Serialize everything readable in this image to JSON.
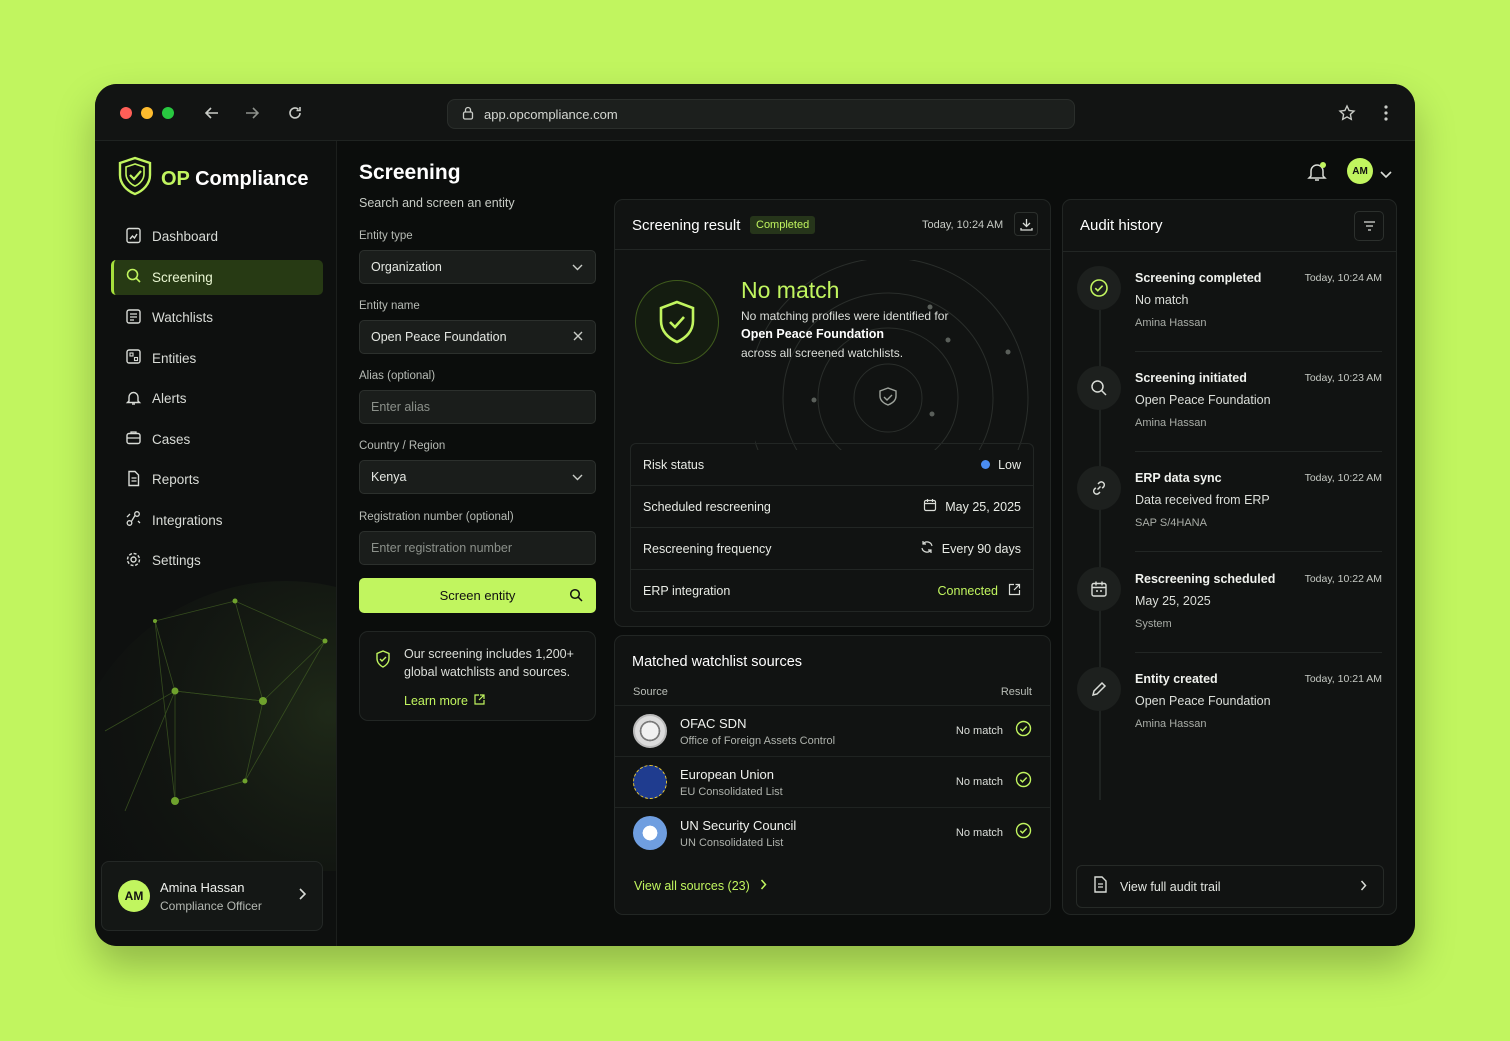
{
  "browser": {
    "url": "app.opcompliance.com"
  },
  "brand": {
    "prefix": "OP",
    "name": "Compliance"
  },
  "nav": [
    {
      "label": "Dashboard",
      "icon": "dashboard-icon"
    },
    {
      "label": "Screening",
      "icon": "search-icon",
      "active": true
    },
    {
      "label": "Watchlists",
      "icon": "list-icon"
    },
    {
      "label": "Entities",
      "icon": "entities-icon"
    },
    {
      "label": "Alerts",
      "icon": "bell-icon"
    },
    {
      "label": "Cases",
      "icon": "briefcase-icon"
    },
    {
      "label": "Reports",
      "icon": "document-icon"
    },
    {
      "label": "Integrations",
      "icon": "integrations-icon"
    },
    {
      "label": "Settings",
      "icon": "gear-icon"
    }
  ],
  "user": {
    "initials": "AM",
    "name": "Amina Hassan",
    "role": "Compliance Officer"
  },
  "page": {
    "title": "Screening",
    "subtitle": "Search and screen an entity"
  },
  "form": {
    "entity_type_label": "Entity type",
    "entity_type_value": "Organization",
    "entity_name_label": "Entity name",
    "entity_name_value": "Open Peace Foundation",
    "alias_label": "Alias (optional)",
    "alias_placeholder": "Enter alias",
    "country_label": "Country / Region",
    "country_value": "Kenya",
    "reg_label": "Registration number (optional)",
    "reg_placeholder": "Enter registration number",
    "submit": "Screen entity"
  },
  "info": {
    "text": "Our screening includes 1,200+ global watchlists and sources.",
    "link": "Learn more"
  },
  "result": {
    "title": "Screening result",
    "badge": "Completed",
    "time": "Today, 10:24 AM",
    "headline": "No match",
    "desc_1": "No matching profiles were identified for",
    "entity": "Open Peace Foundation",
    "desc_2": "across all screened watchlists.",
    "rows": [
      {
        "label": "Risk status",
        "value": "Low"
      },
      {
        "label": "Scheduled rescreening",
        "value": "May 25, 2025"
      },
      {
        "label": "Rescreening frequency",
        "value": "Every 90 days"
      },
      {
        "label": "ERP integration",
        "value": "Connected"
      }
    ]
  },
  "sources": {
    "title": "Matched watchlist sources",
    "col_source": "Source",
    "col_result": "Result",
    "items": [
      {
        "name": "OFAC SDN",
        "sub": "Office of Foreign Assets Control",
        "result": "No match"
      },
      {
        "name": "European Union",
        "sub": "EU Consolidated List",
        "result": "No match"
      },
      {
        "name": "UN Security Council",
        "sub": "UN Consolidated List",
        "result": "No match"
      }
    ],
    "view_all": "View all sources (23)"
  },
  "audit": {
    "title": "Audit history",
    "items": [
      {
        "title": "Screening completed",
        "time": "Today, 10:24 AM",
        "detail": "No match",
        "by": "Amina Hassan",
        "icon": "check-circle-icon"
      },
      {
        "title": "Screening initiated",
        "time": "Today, 10:23 AM",
        "detail": "Open Peace Foundation",
        "by": "Amina Hassan",
        "icon": "search-icon"
      },
      {
        "title": "ERP data sync",
        "time": "Today, 10:22 AM",
        "detail": "Data received from ERP",
        "by": "SAP S/4HANA",
        "icon": "link-icon"
      },
      {
        "title": "Rescreening scheduled",
        "time": "Today, 10:22 AM",
        "detail": "May 25, 2025",
        "by": "System",
        "icon": "calendar-icon"
      },
      {
        "title": "Entity created",
        "time": "Today, 10:21 AM",
        "detail": "Open Peace Foundation",
        "by": "Amina Hassan",
        "icon": "pencil-icon"
      }
    ],
    "view_full": "View full audit trail"
  },
  "colors": {
    "accent": "#c1f55f",
    "background": "#0b0d0c",
    "risk_low": "#4a8cf0"
  }
}
